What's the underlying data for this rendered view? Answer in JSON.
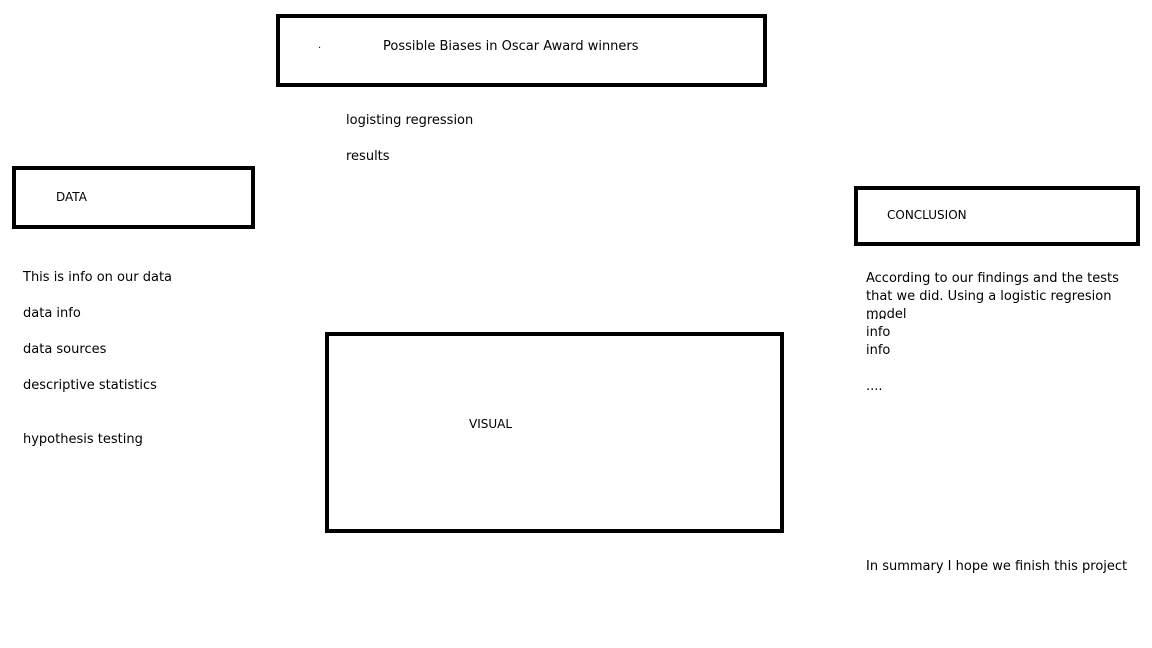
{
  "title": {
    "dot": ".",
    "text": "Possible Biases in Oscar Award winners"
  },
  "methods": {
    "items": [
      "logisting regression",
      "results"
    ]
  },
  "data_section": {
    "label": "DATA",
    "items": [
      "This is info on our data",
      "data info",
      "data sources",
      "descriptive statistics",
      "hypothesis testing"
    ]
  },
  "visual": {
    "label": "VISUAL"
  },
  "conclusion": {
    "label": "CONCLUSION",
    "paragraph": "According to our findings and the tests that we did. Using a logistic regresion model",
    "dots_1": ".....",
    "info_1": "info",
    "info_2": "info",
    "dots_2": "....",
    "summary": "In summary I hope we finish this project"
  }
}
